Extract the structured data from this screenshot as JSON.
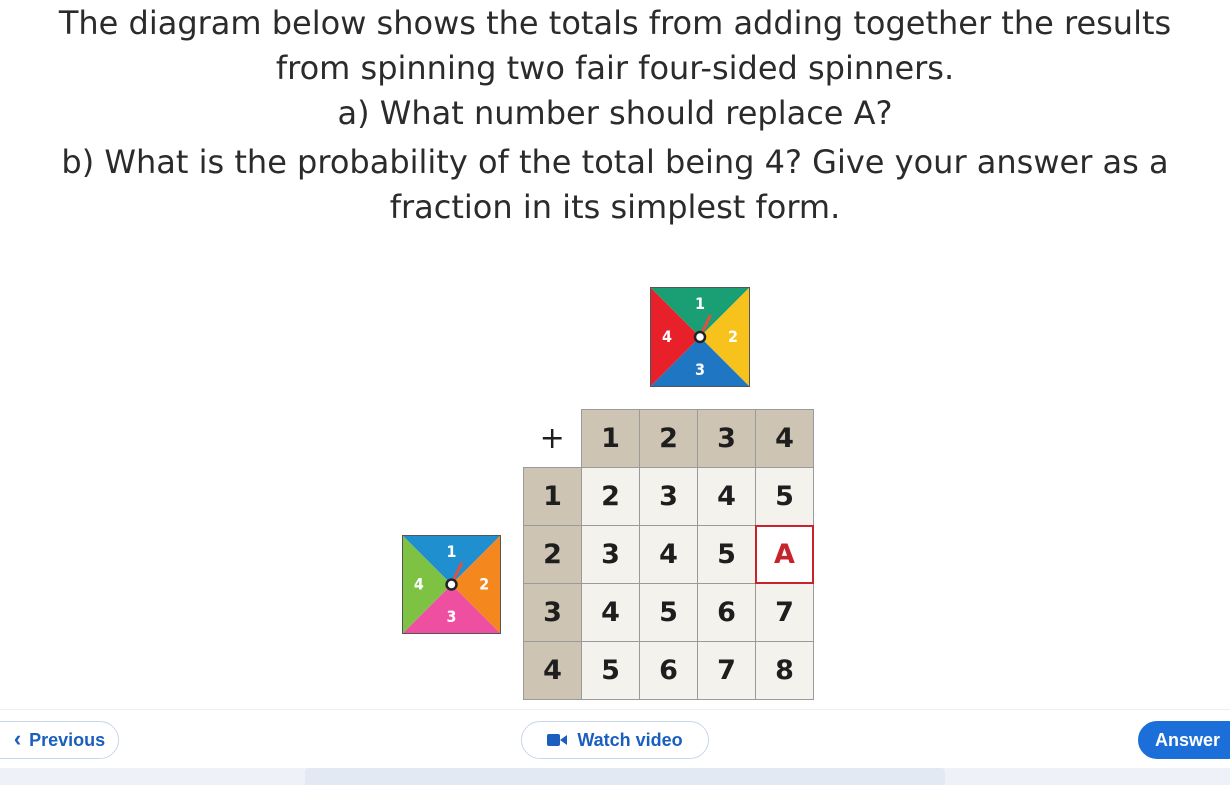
{
  "question": {
    "line1": "The diagram below shows the totals from adding together the results",
    "line2": "from spinning two fair four-sided spinners.",
    "part_a": "a) What number should replace A?",
    "part_b_line1": "b) What is the probability of the total being 4? Give your answer as a",
    "part_b_line2": "fraction in its simplest form."
  },
  "spinner_top": {
    "labels": [
      "1",
      "2",
      "3",
      "4"
    ],
    "colors": {
      "top": "#1a9e73",
      "right": "#f7c21b",
      "bottom": "#1f77c4",
      "left": "#e8202a"
    }
  },
  "spinner_left": {
    "labels": [
      "1",
      "2",
      "3",
      "4"
    ],
    "colors": {
      "top": "#1f8fd0",
      "right": "#f5871f",
      "bottom": "#ee4fa1",
      "left": "#7dc243"
    }
  },
  "grid": {
    "corner": "+",
    "col_headers": [
      "1",
      "2",
      "3",
      "4"
    ],
    "rows": [
      {
        "header": "1",
        "cells": [
          "2",
          "3",
          "4",
          "5"
        ]
      },
      {
        "header": "2",
        "cells": [
          "3",
          "4",
          "5",
          "A"
        ]
      },
      {
        "header": "3",
        "cells": [
          "4",
          "5",
          "6",
          "7"
        ]
      },
      {
        "header": "4",
        "cells": [
          "5",
          "6",
          "7",
          "8"
        ]
      }
    ]
  },
  "nav": {
    "previous_label": "Previous",
    "video_label": "Watch video",
    "answer_label": "Answer"
  },
  "colors": {
    "accent": "#1c6fd8",
    "highlight": "#c8232c",
    "header_cell": "#cec4b4"
  }
}
